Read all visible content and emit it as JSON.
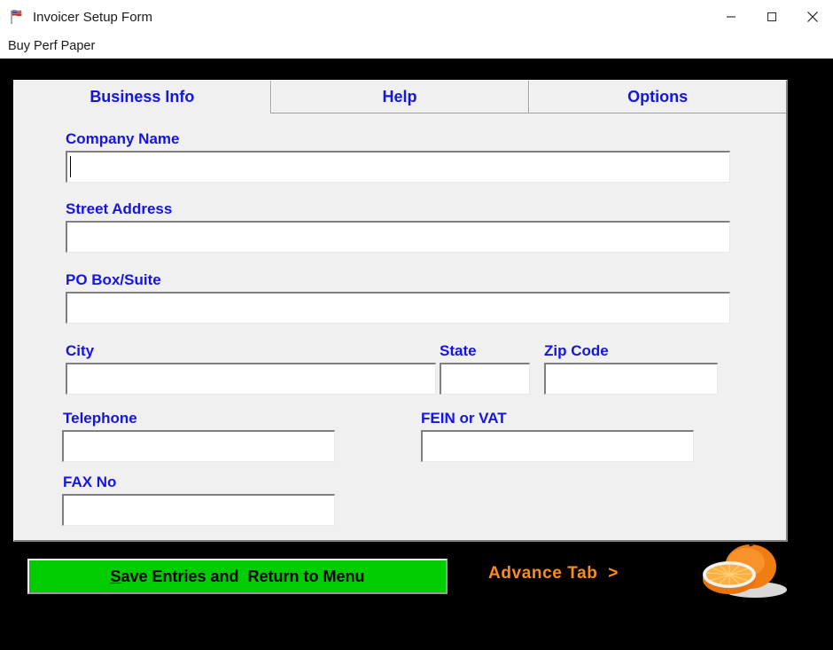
{
  "window": {
    "title": "Invoicer Setup Form",
    "icon": "flag-icon",
    "controls": {
      "minimize": "minimize-icon",
      "maximize": "maximize-icon",
      "close": "close-icon"
    }
  },
  "menubar": {
    "items": [
      {
        "label": "Buy Perf Paper"
      }
    ]
  },
  "tabs": [
    {
      "label": "Business Info",
      "active": true
    },
    {
      "label": "Help",
      "active": false
    },
    {
      "label": "Options",
      "active": false
    }
  ],
  "form": {
    "fields": [
      {
        "label": "Company Name",
        "value": "",
        "placeholder": "",
        "focused": true
      },
      {
        "label": "Street Address",
        "value": "",
        "placeholder": "",
        "focused": false
      },
      {
        "label": "PO Box/Suite",
        "value": "",
        "placeholder": "",
        "focused": false
      },
      {
        "label": "City",
        "value": "",
        "placeholder": "",
        "focused": false
      },
      {
        "label": "State",
        "value": "",
        "placeholder": "",
        "focused": false
      },
      {
        "label": "Zip Code",
        "value": "",
        "placeholder": "",
        "focused": false
      },
      {
        "label": "Telephone",
        "value": "",
        "placeholder": "",
        "focused": false
      },
      {
        "label": "FEIN or VAT",
        "value": "",
        "placeholder": "",
        "focused": false
      },
      {
        "label": "FAX No",
        "value": "",
        "placeholder": "",
        "focused": false
      }
    ]
  },
  "footer": {
    "save_accel": "S",
    "save_label_rest": "ave Entries and  Return to Menu",
    "advance_tab_label": "Advance Tab  >",
    "artwork": "orange-fruit-image"
  },
  "colors": {
    "app_background": "#000000",
    "panel": "#f0f0f0",
    "label_blue": "#1414e6",
    "save_green": "#00cc00",
    "advance_orange": "#ff8c1a",
    "titlebar": "#ffffff"
  }
}
